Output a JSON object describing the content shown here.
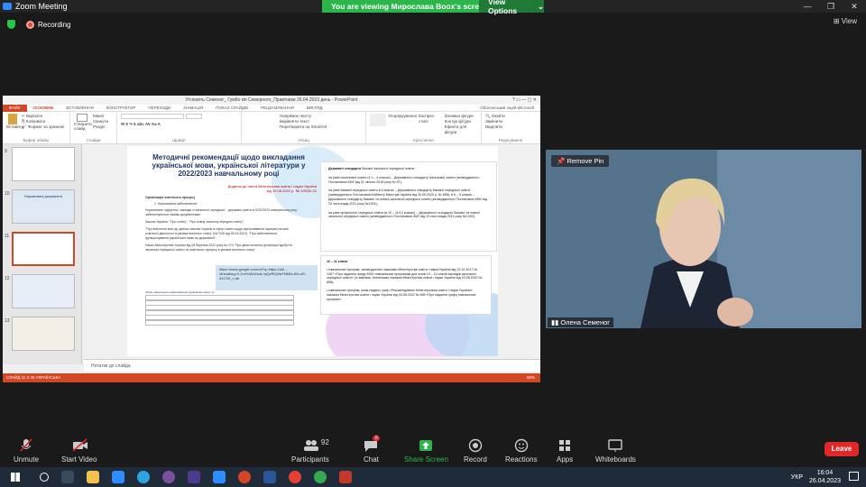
{
  "window": {
    "title": "Zoom Meeting",
    "viewing_banner": "You are viewing Мирослава Boox's screen",
    "view_options": "View Options",
    "controls": [
      "—",
      "❐",
      "✕"
    ]
  },
  "recording": {
    "label": "Recording",
    "view_button": "View"
  },
  "powerpoint": {
    "window_title": "Угсповіть Семеног_ Гумбо кія Семерного_Правтовки 26.04.2023 день - PowerPoint",
    "user": "Оболонський ліцей Microsoft",
    "tabs": [
      "ФАЙЛ",
      "ОСНОВНЕ",
      "ВСТАВЛЕННЯ",
      "КОНСТРУКТОР",
      "ПЕРЕХОДИ",
      "АНІМАЦІЯ",
      "ПОКАЗ СЛАЙДІВ",
      "РЕЦЕНЗУВАННЯ",
      "ВИГЛЯД"
    ],
    "ribbon_groups": [
      "Буфер обміну",
      "Слайди",
      "Шрифт",
      "Абзац",
      "Креслення",
      "Редагування"
    ],
    "ribbon_buttons": {
      "paste": "Вставити",
      "copy": "Копіювати",
      "format": "Формат за зразком",
      "new_slide": "Створити слайд",
      "layout": "Макет",
      "reset": "Скинути",
      "section": "Розділ",
      "arrange": "Упорядкування",
      "quick_styles": "Експрес-стилі",
      "find": "Знайти",
      "replace": "Замінити",
      "select": "Виділити",
      "fill": "Заливка фігури",
      "outline": "Контур фігури",
      "effects": "Ефекти для фігури",
      "text_direction": "Напрямок тексту",
      "align_text": "Вирівняти текст",
      "smartart": "Перетворити на SmartArt"
    },
    "slide_numbers": [
      "9",
      "10",
      "11",
      "12",
      "13"
    ],
    "thumb_title_10": "Нормативні документи",
    "notes_placeholder": "Нотатки до слайда",
    "status": "СЛАЙД 11 З 40   УКРАЇНСЬКА",
    "zoom": "55%",
    "slide": {
      "title": "Методичні рекомендації щодо викладання української мови, української літератури у 2022/2023 навчальному році",
      "subtitle": "Додаток до листа Міністерства освіти і науки України від 19.08.2022 р. № 1/9530-22",
      "doc_lines": [
        "Організація освітнього процесу",
        "1. Нормативна забезпечення",
        "Нормативне підґрунтя: заклади із загальної середньої... державні освіти в 2022/2023 навчальному році забезпечуються такими документами:",
        "Закони України: \"Про освіту\", \"Про повну загальну середню освіту\";",
        "\"Про внесення змін до деяких законів України в сфері освіти щодо врегулювання окремих питань освітньої діяльності в умовах воєнного стану\" (№7125 від 28.04.2022), \"Про забезпечення функціонування української мови як державної\";",
        "Наказ Міністерства України від 28 березня 2022 року № 274 \"Про деякі питання організації здобуття загальної середньої освіти та освітнього процесу в умовах воєнного стану\""
      ],
      "popup": "https://www.google.com/url?q=https://dol.... /#heading=h.2mYuWxZs4s /qQzRtQ9aYMkBx-thb-oR-d1CS9_v ab",
      "table_caption": "Обсяг навчального навантаження здобувачів освіти та ...",
      "right_title": "Державні стандарти",
      "right_title_rest": "базової загальної середньої освіти:",
      "right_paragraphs": [
        "на рівні початкової освіти (з 1 – 4 класах) – Державного стандарту початкової освіти (затвердженого Постановою КМУ від 21 лютого 2018 року № 87);",
        "на рівні базової середньої освіти в 5 класах – Державного стандарту базової середньої освіти (затвердженого Постановою Кабінету Міністрів України від 30.09.2020 р. № 898); в 6 – 9 класах – Державного стандарту базової та повної загальної середньої освіти (затвердженого Постановою КМУ від 23 листопада 2011 року №1392);",
        "на рівні профільної середньої освіти (в 10 – 11/12 класах) – Державного стандарту базової та повної загальної середньої освіти (затвердженого Постановою КМУ від 23 листопада 2011 року №1392)."
      ],
      "grade_heading": "10 – 11 класи",
      "grade_items": [
        "навчальних програм, затверджених наказами Міністерства освіти і науки України від 23.10.2017 № 1407 «Про надання грифу МОН навчальним програмам для учнів 10 – 11 класів закладів загальної середньої освіти» (зі змінами, внесеними наказом Міністерства освіти і науки України від 03.08.2022 № 698);",
        "навчальних програм, яким надано гриф «Рекомендовано Міністерством освіти і науки України» наказом Міністерства освіти і науки України від 03.08.2022 № 698 «Про надання грифу навчальних програм»."
      ]
    }
  },
  "speaker": {
    "name": "Олена Семеног",
    "remove_pin": "Remove Pin"
  },
  "toolbar": {
    "unmute": "Unmute",
    "start_video": "Start Video",
    "participants": "Participants",
    "participants_count": "92",
    "chat": "Chat",
    "chat_badge": "8",
    "share": "Share Screen",
    "record": "Record",
    "reactions": "Reactions",
    "apps": "Apps",
    "whiteboards": "Whiteboards",
    "leave": "Leave"
  },
  "taskbar": {
    "time": "16:04",
    "date": "26.04.2023",
    "lang": "УКР"
  },
  "colors": {
    "share_green": "#2bb54a",
    "leave_red": "#e02828",
    "ppt_orange": "#d24726",
    "accent_blue": "#2d8cff"
  }
}
